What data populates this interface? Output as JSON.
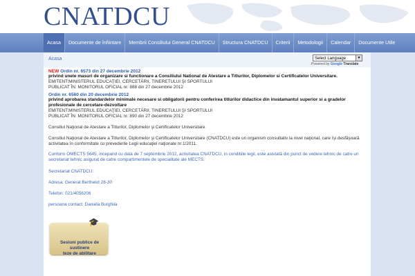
{
  "header": {
    "logo": "CNATDCU"
  },
  "nav": {
    "items": [
      {
        "label": "Acasa",
        "active": true
      },
      {
        "label": "Documente de înfiintare"
      },
      {
        "label": "Membrii Consiliului General CNATDCU"
      },
      {
        "label": "Structura CNATDCU"
      },
      {
        "label": "Criterii"
      },
      {
        "label": "Metodologii"
      },
      {
        "label": "Calendar"
      },
      {
        "label": "Documente Utile"
      }
    ]
  },
  "language": {
    "selected": "Select Language",
    "powered_by": "Powered by",
    "google": "Google",
    "translate": "Translate"
  },
  "breadcrumb": "Acasa",
  "ordin1": {
    "new_tag": "NEW",
    "title": "Ordin nr. 6573 din 27 decembrie 2012",
    "desc": "privind unele masuri de organizare si functionare a Consiliului National de Atestare a Titlurilor, Diplomelor si Certificatelor Universitare.",
    "emitent": "EMITENT:MINISTERUL EDUCAŢIEI, CERCETĂRII, TINERETULUI ŞI SPORTULUI",
    "publicat": "PUBLICAT ÎN: MONITORUL OFICIAL nr. 888 din 27 decembrie 2012"
  },
  "ordin2": {
    "title": "Ordin nr. 6560 din 20 decembrie 2012",
    "desc": "privind aprobarea standardelor minimale necesare si obligatorii pentru conferirea titlurilor didactice din invatamantul superior si a gradelor profesionale de cercetare-dezvoltare",
    "emitent": "EMITENT:MINISTERUL EDUCAŢIEI, CERCETĂRII, TINERETULUI ŞI SPORTULUI",
    "publicat": "PUBLICAT ÎN: MONITORUL OFICIAL nr. 890 din 27 decembrie 2012"
  },
  "intro": {
    "heading": "Consiliul Naţional de Atestare a Titlurilor, Diplomelor şi Certificatelor Universitare",
    "paragraph": "Consiliul Naţional de Atestare a Titlurilor, Diplomelor şi Certificatelor Universitare (CNATDCU) este un organism consultativ la nivel naţional, care îşi desfăşoară activitatea în conformitate cu prevederile Legii educaţiei naţionale nr.1/2011.",
    "conform": "Conform OMECTS 5645, incepand cu data de 7 septembrie 2012, activitatea CNATDCU, in conditiile legii, este asistată din punct de vedere tehnic de catre un secretariat tehnic asigurat de catre compartimentele de specialitate ale MECTS."
  },
  "contact": {
    "secretariat": "Secretariat CNATDCU:",
    "adresa": "Adresa: General Berthelot 28-30",
    "telefon": "Telefon: 021/4056206",
    "persoana": "persoana contact: Daniela Burghila"
  },
  "banner": {
    "line1": "Sesiuni publice de sustinere",
    "line2": "teze de abilitare"
  },
  "colors": {
    "brand": "#33508c",
    "nav": "#6b8bc8",
    "side": "#d9e3f3",
    "link": "#2d5fb0",
    "new": "#e01818"
  }
}
